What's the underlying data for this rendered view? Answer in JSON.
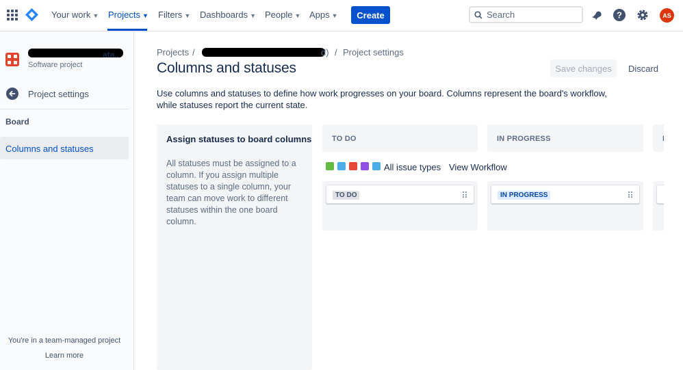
{
  "nav": {
    "items": [
      {
        "label": "Your work",
        "active": false
      },
      {
        "label": "Projects",
        "active": true
      },
      {
        "label": "Filters",
        "active": false
      },
      {
        "label": "Dashboards",
        "active": false
      },
      {
        "label": "People",
        "active": false
      },
      {
        "label": "Apps",
        "active": false
      }
    ],
    "create_label": "Create",
    "search_placeholder": "Search",
    "avatar_initials": "AS",
    "accent_color": "#0052cc"
  },
  "sidebar": {
    "project_name_visible": "ata..",
    "project_type": "Software project",
    "back_label": "Project settings",
    "section_heading": "Board",
    "active_item": "Columns and statuses",
    "footer_text": "You're in a team-managed project",
    "footer_link": "Learn more"
  },
  "main": {
    "breadcrumb_first": "Projects",
    "breadcrumb_sep": "/",
    "breadcrumb_middle_tail": "d)",
    "breadcrumb_last": "Project settings",
    "title": "Columns and statuses",
    "save_label": "Save changes",
    "discard_label": "Discard",
    "description": "Use columns and statuses to define how work progresses on your board. Columns represent the board's workflow, while statuses report the current state.",
    "assign_title": "Assign statuses to board columns",
    "assign_text": "All statuses must be assigned to a column. If you assign multiple statuses to a single column, your team can move work to different statuses within the one board column.",
    "issue_types_label": "All issue types",
    "view_workflow_label": "View Workflow",
    "columns": [
      {
        "header": "TO DO",
        "status": "TO DO"
      },
      {
        "header": "IN PROGRESS",
        "status": "IN PROGRESS"
      },
      {
        "header": "D",
        "status": ""
      }
    ]
  }
}
